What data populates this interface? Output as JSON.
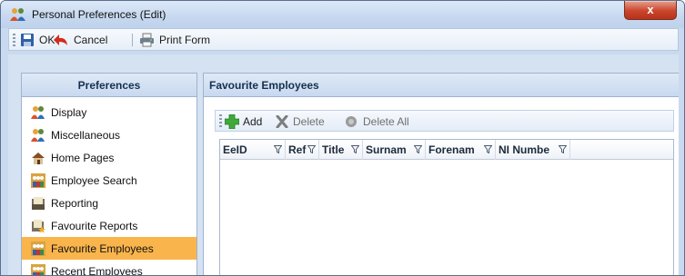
{
  "window": {
    "title": "Personal Preferences (Edit)",
    "close_glyph": "x"
  },
  "toolbar": {
    "ok_label": "OK",
    "cancel_label": "Cancel",
    "print_label": "Print Form"
  },
  "preferences": {
    "header": "Preferences",
    "items": [
      {
        "label": "Display",
        "icon": "people-icon"
      },
      {
        "label": "Miscellaneous",
        "icon": "people-icon"
      },
      {
        "label": "Home Pages",
        "icon": "home-icon"
      },
      {
        "label": "Employee Search",
        "icon": "employee-group-icon"
      },
      {
        "label": "Reporting",
        "icon": "report-icon"
      },
      {
        "label": "Favourite Reports",
        "icon": "report-star-icon"
      },
      {
        "label": "Favourite Employees",
        "icon": "employee-group-icon",
        "selected": true
      },
      {
        "label": "Recent Employees",
        "icon": "employee-group-icon"
      }
    ]
  },
  "favourites": {
    "header": "Favourite Employees",
    "add_label": "Add",
    "delete_label": "Delete",
    "delete_all_label": "Delete All",
    "columns": [
      "EeID",
      "Ref",
      "Title",
      "Surnam",
      "Forenam",
      "NI Numbe"
    ]
  },
  "colors": {
    "selected_item": "#f9b44c",
    "close_button": "#c9452b",
    "panel_header": "#c8d9ef"
  }
}
